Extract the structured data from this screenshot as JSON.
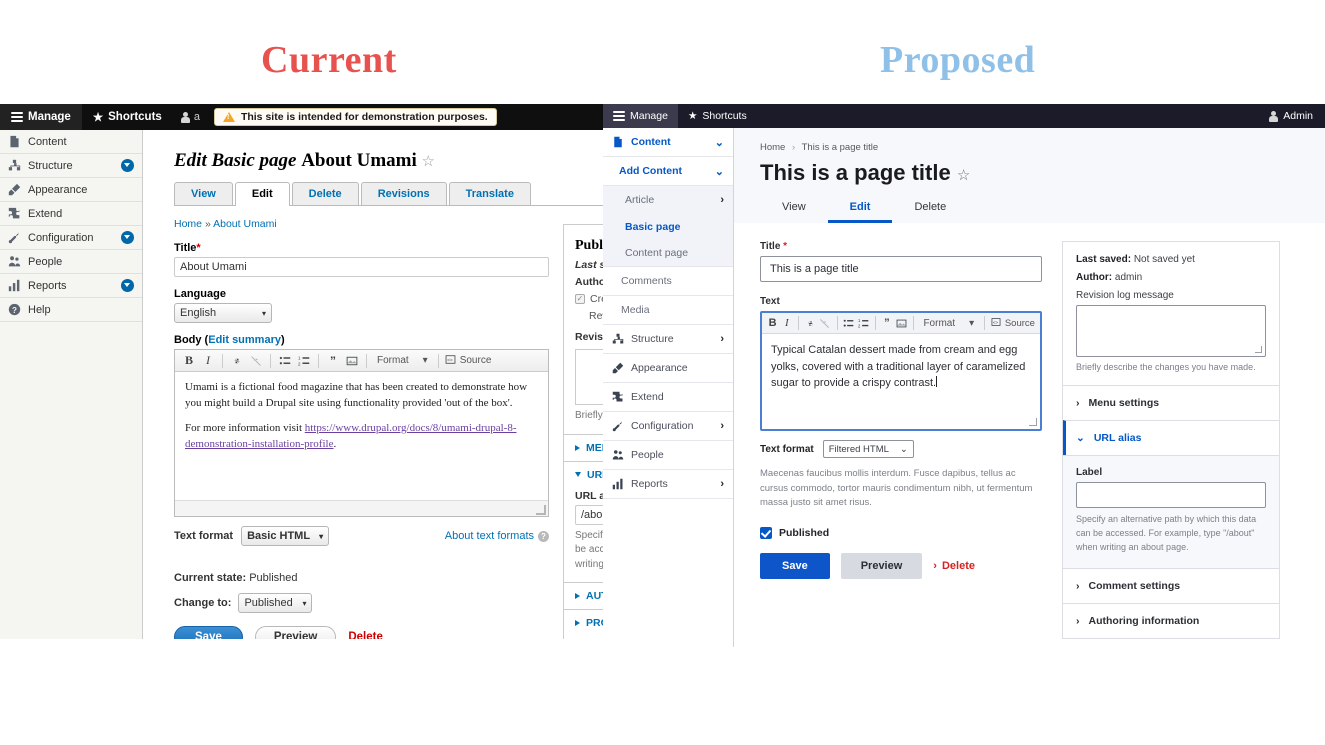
{
  "headings": {
    "current": "Current",
    "proposed": "Proposed"
  },
  "current": {
    "toolbar": {
      "manage": "Manage",
      "shortcuts": "Shortcuts",
      "user": "a",
      "banner": "This site is intended for demonstration purposes."
    },
    "sidebar": [
      {
        "label": "Content",
        "icon": "document-icon",
        "caret": false
      },
      {
        "label": "Structure",
        "icon": "structure-icon",
        "caret": true
      },
      {
        "label": "Appearance",
        "icon": "paintbrush-icon",
        "caret": false
      },
      {
        "label": "Extend",
        "icon": "puzzle-icon",
        "caret": false
      },
      {
        "label": "Configuration",
        "icon": "wrench-icon",
        "caret": true
      },
      {
        "label": "People",
        "icon": "people-icon",
        "caret": false
      },
      {
        "label": "Reports",
        "icon": "bars-icon",
        "caret": true
      },
      {
        "label": "Help",
        "icon": "question-icon",
        "caret": false
      }
    ],
    "page_title_prefix": "Edit Basic page",
    "page_title": "About Umami",
    "tabs": [
      "View",
      "Edit",
      "Delete",
      "Revisions",
      "Translate"
    ],
    "active_tab": "Edit",
    "breadcrumb_home": "Home",
    "breadcrumb_sep": "»",
    "breadcrumb_current": "About Umami",
    "title_label": "Title",
    "title_value": "About Umami",
    "language_label": "Language",
    "language_value": "English",
    "body_label": "Body",
    "body_edit_summary": "Edit summary",
    "toolbar_format": "Format",
    "toolbar_source": "Source",
    "body_p1": "Umami is a fictional food magazine that has been created to demonstrate how you might build a Drupal site using functionality provided 'out of the box'.",
    "body_p2_pre": "For more information visit ",
    "body_p2_link": "https://www.drupal.org/docs/8/umami-drupal-8-demonstration-installation-profile",
    "body_p2_post": ".",
    "text_format_label": "Text format",
    "text_format_value": "Basic HTML",
    "about_text_formats": "About text formats",
    "current_state_label": "Current state:",
    "current_state_value": "Published",
    "change_to_label": "Change to:",
    "change_to_value": "Published",
    "save": "Save",
    "preview": "Preview",
    "delete": "Delete",
    "meta": {
      "published_heading": "Published",
      "last_saved": "Last saved:",
      "author_label": "Author: Sa",
      "create_revision": "Create ",
      "revision_line": "Revision",
      "revision_log_label": "Revision l",
      "briefly": "Briefly desc",
      "menu_settings": "MENU SE",
      "url_alias": "URL ALIA",
      "url_alias_label": "URL alias",
      "url_alias_value": "/about-u",
      "url_help_1": "Specify an",
      "url_help_2": "be accesse",
      "url_help_3": "writing an ",
      "authoring": "AUTHORI",
      "promotion": "PROMOTI"
    }
  },
  "proposed": {
    "toolbar": {
      "manage": "Manage",
      "shortcuts": "Shortcuts",
      "admin": "Admin"
    },
    "sidebar": [
      {
        "label": "Content",
        "icon": "document-icon",
        "level": "lvl1",
        "chev": "down"
      },
      {
        "label": "Add Content",
        "icon": "",
        "level": "lvl1-indent",
        "chev": "down"
      },
      {
        "label": "Article",
        "icon": "",
        "level": "sub",
        "chev": "right"
      },
      {
        "label": "Basic page",
        "icon": "",
        "level": "sub-sel",
        "chev": ""
      },
      {
        "label": "Content page",
        "icon": "",
        "level": "sub",
        "chev": ""
      },
      {
        "label": "Comments",
        "icon": "",
        "level": "plain",
        "chev": ""
      },
      {
        "label": "Media",
        "icon": "",
        "level": "plain",
        "chev": ""
      },
      {
        "label": "Structure",
        "icon": "structure-icon",
        "level": "top",
        "chev": "right"
      },
      {
        "label": "Appearance",
        "icon": "paintbrush-icon",
        "level": "top",
        "chev": ""
      },
      {
        "label": "Extend",
        "icon": "puzzle-icon",
        "level": "top",
        "chev": ""
      },
      {
        "label": "Configuration",
        "icon": "wrench-icon",
        "level": "top",
        "chev": "right"
      },
      {
        "label": "People",
        "icon": "people-icon",
        "level": "top",
        "chev": ""
      },
      {
        "label": "Reports",
        "icon": "bars-icon",
        "level": "top",
        "chev": "right"
      }
    ],
    "breadcrumb_home": "Home",
    "breadcrumb_sep": "›",
    "breadcrumb_current": "This is a page title",
    "page_title": "This is a page title",
    "tabs": [
      "View",
      "Edit",
      "Delete"
    ],
    "active_tab": "Edit",
    "title_label": "Title",
    "title_value": "This is a page title",
    "text_label": "Text",
    "toolbar_format": "Format",
    "toolbar_source": "Source",
    "text_value": "Typical Catalan dessert made from cream and egg yolks, covered with a traditional layer of caramelized sugar to provide a crispy contrast.",
    "text_format_label": "Text format",
    "text_format_value": "Filtered HTML",
    "text_help": "Maecenas faucibus mollis interdum. Fusce dapibus, tellus ac cursus commodo, tortor mauris condimentum nibh, ut fermentum massa justo sit amet risus.",
    "published_label": "Published",
    "save": "Save",
    "preview": "Preview",
    "delete": "Delete",
    "aside": {
      "last_saved_label": "Last saved:",
      "last_saved_value": "Not saved yet",
      "author_label": "Author:",
      "author_value": "admin",
      "revision_log_label": "Revision log message",
      "revision_log_value": "",
      "revision_help": "Briefly describe the changes you have made.",
      "menu_settings": "Menu settings",
      "url_alias": "URL alias",
      "url_label": "Label",
      "url_value": "",
      "url_help": "Specify an alternative path by which this data can be accessed. For example, type \"/about\" when writing an about page.",
      "comment_settings": "Comment settings",
      "authoring_information": "Authoring information"
    }
  },
  "colors": {
    "current_red": "#e8524e",
    "proposed_blue": "#8ec0e8",
    "claro_accent": "#0558c6",
    "danger": "#d72222"
  }
}
